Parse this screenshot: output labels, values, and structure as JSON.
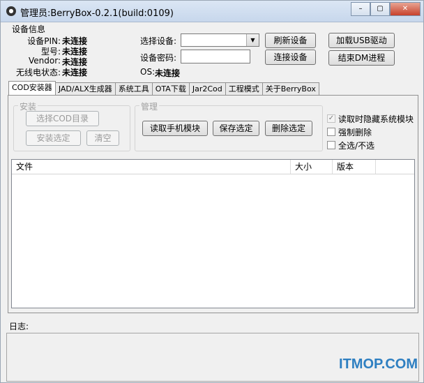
{
  "window": {
    "title": "管理员:BerryBox-0.2.1(build:0109)",
    "app_icon": "blackberry-icon",
    "controls": [
      "–",
      "▢",
      "✕"
    ]
  },
  "device_info": {
    "group_title": "设备信息",
    "pin_label": "设备PIN:",
    "pin_value": "未连接",
    "model_label": "型号:",
    "model_value": "未连接",
    "vendor_label": "Vendor:",
    "vendor_value": "未连接",
    "wireless_label": "无线电状态:",
    "wireless_value": "未连接",
    "select_device_label": "选择设备:",
    "select_device_value": "",
    "password_label": "设备密码:",
    "password_value": "",
    "os_label": "OS:",
    "os_value": "未连接",
    "refresh_button": "刷新设备",
    "connect_button": "连接设备",
    "load_usb_button": "加载USB驱动",
    "end_dm_button": "结束DM进程"
  },
  "tabs": [
    "COD安装器",
    "JAD/ALX生成器",
    "系统工具",
    "OTA下载",
    "Jar2Cod",
    "工程模式",
    "关于BerryBox"
  ],
  "install": {
    "group_title": "安装",
    "select_dir_button": "选择COD目录",
    "install_selected_button": "安装选定",
    "clear_button": "清空"
  },
  "manage": {
    "group_title": "管理",
    "read_modules_button": "读取手机模块",
    "save_selected_button": "保存选定",
    "delete_selected_button": "删除选定"
  },
  "options": {
    "hide_system": "读取时隐藏系统模块",
    "hide_system_checked": true,
    "force_delete": "强制删除",
    "select_all": "全选/不选"
  },
  "table": {
    "columns": [
      "文件",
      "大小",
      "版本"
    ],
    "rows": []
  },
  "log": {
    "label": "日志:",
    "content": ""
  },
  "watermark": "ITMOP.COM"
}
